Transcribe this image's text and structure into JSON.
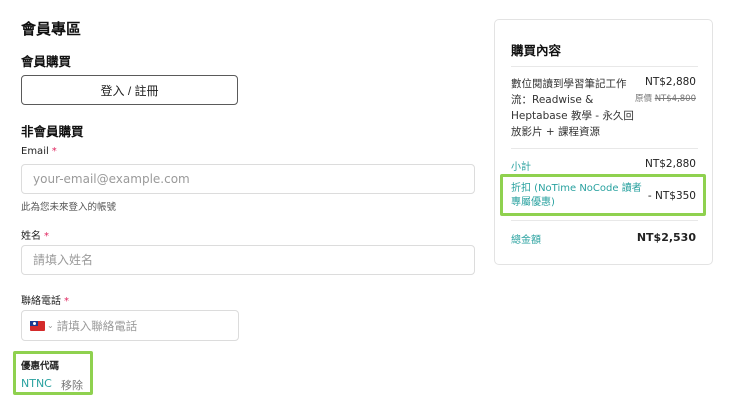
{
  "left": {
    "member_area_title": "會員專區",
    "member_purchase_title": "會員購買",
    "login_button_label": "登入 / 註冊",
    "guest_purchase_title": "非會員購買",
    "email": {
      "label": "Email",
      "required_mark": "*",
      "placeholder": "your-email@example.com",
      "value": "",
      "hint": "此為您未來登入的帳號"
    },
    "name": {
      "label": "姓名",
      "required_mark": "*",
      "placeholder": "請填入姓名",
      "value": ""
    },
    "phone": {
      "label": "聯絡電話",
      "required_mark": "*",
      "country_flag": "taiwan-flag-icon",
      "placeholder": "請填入聯絡電話",
      "value": ""
    },
    "coupon": {
      "label": "優惠代碼",
      "code": "NTNC",
      "remove_label": "移除"
    }
  },
  "summary": {
    "title": "購買內容",
    "product_name": "數位閱讀到學習筆記工作流：Readwise & Heptabase 教學 - 永久回放影片 + 課程資源",
    "product_price": "NT$2,880",
    "original_price_label": "原價",
    "original_price_value": "NT$4,800",
    "subtotal_label": "小計",
    "subtotal_value": "NT$2,880",
    "discount_label": "折扣 (NoTime NoCode 讀者專屬優惠)",
    "discount_value": "- NT$350",
    "total_label": "總金額",
    "total_value": "NT$2,530"
  },
  "colors": {
    "accent_teal": "#2aa2a0",
    "required_red": "#e0245e",
    "highlight_green": "#8fd14f"
  }
}
